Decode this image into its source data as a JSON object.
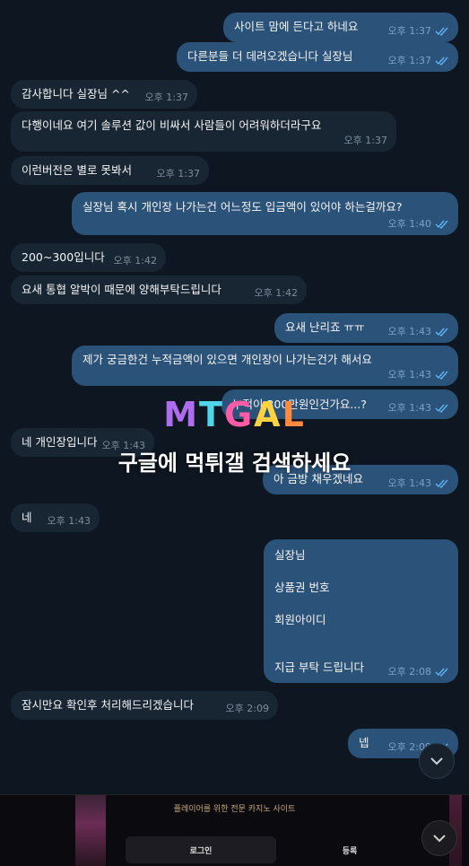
{
  "messages": [
    {
      "side": "out",
      "text": "사이트 맘에 든다고 하네요",
      "time": "오후 1:37",
      "read": true
    },
    {
      "side": "out",
      "text": "다른분들 더 데려오겠습니다 실장님",
      "time": "오후 1:37",
      "read": true
    },
    {
      "side": "in",
      "text": "감사합니다 실장님 ^^",
      "time": "오후 1:37"
    },
    {
      "side": "in",
      "text": "다행이네요 여기 솔루션 값이 비싸서 사람들이 어려워하더라구요",
      "time": "오후 1:37"
    },
    {
      "side": "in",
      "text": "이런버전은 별로 못봐서",
      "time": "오후 1:37"
    },
    {
      "side": "out",
      "text": "실장님 혹시 개인장 나가는건 어느정도 입금액이 있어야 하는걸까요?",
      "time": "오후 1:40",
      "read": true
    },
    {
      "side": "in",
      "text": "200~300입니다",
      "time": "오후 1:42"
    },
    {
      "side": "in",
      "text": "요새 통협 알박이 때문에 양해부탁드립니다",
      "time": "오후 1:42"
    },
    {
      "side": "out",
      "text": "요새 난리죠 ㅠㅠ",
      "time": "오후 1:43",
      "read": true
    },
    {
      "side": "out",
      "text": "제가 궁금한건 누적금액이 있으면 개인장이 나가는건가 해서요",
      "time": "오후 1:43",
      "read": true
    },
    {
      "side": "out",
      "text": "누적이 300만원인건가요...?",
      "time": "오후 1:43",
      "read": true
    },
    {
      "side": "in",
      "text": "네 개인장입니다",
      "time": "오후 1:43"
    },
    {
      "side": "out",
      "text": "아 금방 채우겠네요",
      "time": "오후 1:43",
      "read": true
    },
    {
      "side": "in",
      "text": "네",
      "time": "오후 1:43"
    },
    {
      "side": "out",
      "lines": [
        "실장님",
        "상품권 번호",
        "회원아이디",
        "",
        "지급 부탁 드립니다"
      ],
      "time": "오후 2:08",
      "read": true
    },
    {
      "side": "in",
      "text": "잠시만요 확인후 처리해드리겠습니다",
      "time": "오후 2:09"
    },
    {
      "side": "out",
      "text": "넵",
      "time": "오후 2:09",
      "read": true
    }
  ],
  "watermark": {
    "logo": [
      "M",
      "T",
      "G",
      "A",
      "L"
    ],
    "logo_colors": [
      "#b06cf0",
      "#4fd6e8",
      "#ff5aa8",
      "#ffd23f",
      "#ff8a3d"
    ],
    "subtitle": "구글에 먹튀갤 검색하세요"
  },
  "banner": {
    "title": "플레이어를 위한 전문 카지노 사이트",
    "login_label": "로그인",
    "register_label": "등록"
  },
  "colors": {
    "background": "#0e1621",
    "incoming_bubble": "#182533",
    "outgoing_bubble": "#2b5278",
    "read_check": "#5eb5f7"
  }
}
